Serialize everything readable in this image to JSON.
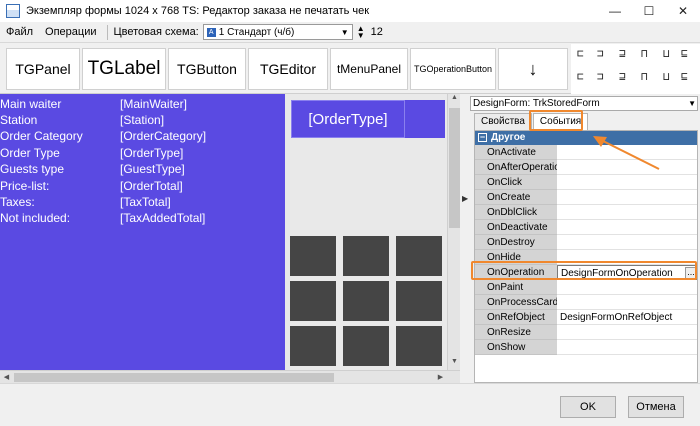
{
  "window": {
    "title": "Экземпляр формы 1024 х 768 TS: Редактор заказа не печатать чек",
    "minimize_glyph": "—",
    "maximize_glyph": "☐",
    "close_glyph": "✕"
  },
  "menu": {
    "file": "Файл",
    "operations": "Операции",
    "color_scheme_label": "Цветовая схема:",
    "color_scheme_value": "1 Стандарт (ч/б)",
    "spin_value": "12"
  },
  "toolbar": {
    "buttons": [
      "TGPanel",
      "TGLabel",
      "TGButton",
      "TGEditor",
      "tMenuPanel",
      "TGOperationButton"
    ],
    "down_arrow": "↓"
  },
  "canvas": {
    "info_rows": [
      {
        "key": "Main waiter",
        "value": "[MainWaiter]"
      },
      {
        "key": "Station",
        "value": "[Station]"
      },
      {
        "key": "Order Category",
        "value": "[OrderCategory]"
      },
      {
        "key": "Order Type",
        "value": "[OrderType]"
      },
      {
        "key": "Guests type",
        "value": "[GuestType]"
      },
      {
        "key": "Price-list:",
        "value": "[OrderTotal]"
      },
      {
        "key": "Taxes:",
        "value": "[TaxTotal]"
      },
      {
        "key": "Not included:",
        "value": "[TaxAddedTotal]"
      }
    ],
    "order_type_button": "[OrderType]"
  },
  "inspector": {
    "object": "DesignForm: TrkStoredForm",
    "tabs": [
      "Свойства",
      "События"
    ],
    "active_tab": "События",
    "category": "Другое",
    "events": [
      {
        "name": "OnActivate",
        "value": ""
      },
      {
        "name": "OnAfterOperation",
        "value": ""
      },
      {
        "name": "OnClick",
        "value": ""
      },
      {
        "name": "OnCreate",
        "value": ""
      },
      {
        "name": "OnDblClick",
        "value": ""
      },
      {
        "name": "OnDeactivate",
        "value": ""
      },
      {
        "name": "OnDestroy",
        "value": ""
      },
      {
        "name": "OnHide",
        "value": ""
      },
      {
        "name": "OnOperation",
        "value": "DesignFormOnOperation"
      },
      {
        "name": "OnPaint",
        "value": ""
      },
      {
        "name": "OnProcessCard",
        "value": ""
      },
      {
        "name": "OnRefObject",
        "value": "DesignFormOnRefObject"
      },
      {
        "name": "OnResize",
        "value": ""
      },
      {
        "name": "OnShow",
        "value": ""
      }
    ],
    "ellipsis": "..."
  },
  "footer": {
    "ok": "OK",
    "cancel": "Отмена"
  },
  "colors": {
    "panel_purple": "#5a4ae2",
    "category_blue": "#3e6fa6",
    "highlight_orange": "#f0882e",
    "tile_dark": "#454545"
  }
}
